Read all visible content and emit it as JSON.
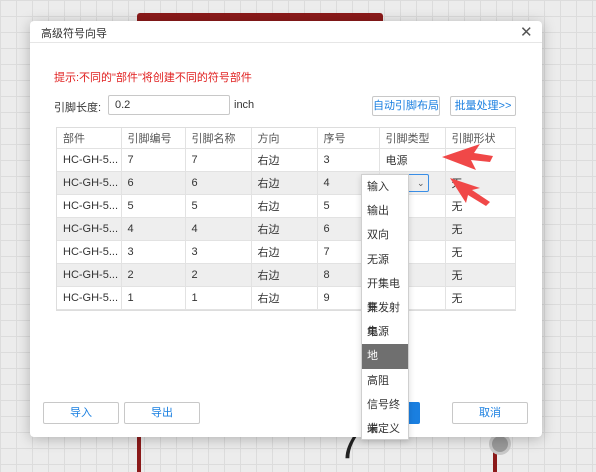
{
  "dialog": {
    "title": "高级符号向导",
    "close_glyph": "✕",
    "hint": "提示:不同的\"部件\"将创建不同的符号部件",
    "pin_length_label": "引脚长度:",
    "pin_length_value": "0.2",
    "pin_length_unit": "inch",
    "auto_layout_label": "自动引脚布局",
    "batch_label": "批量处理>>",
    "import_label": "导入",
    "export_label": "导出",
    "cancel_label": "取消"
  },
  "table": {
    "headers": [
      "部件",
      "引脚编号",
      "引脚名称",
      "方向",
      "序号",
      "引脚类型",
      "引脚形状"
    ],
    "rows": [
      {
        "part": "HC-GH-5...",
        "num": "7",
        "name": "7",
        "dir": "右边",
        "seq": "3",
        "type": "电源",
        "shape": ""
      },
      {
        "part": "HC-GH-5...",
        "num": "6",
        "name": "6",
        "dir": "右边",
        "seq": "4",
        "type": "地",
        "shape": "无"
      },
      {
        "part": "HC-GH-5...",
        "num": "5",
        "name": "5",
        "dir": "右边",
        "seq": "5",
        "type": "",
        "shape": "无"
      },
      {
        "part": "HC-GH-5...",
        "num": "4",
        "name": "4",
        "dir": "右边",
        "seq": "6",
        "type": "",
        "shape": "无"
      },
      {
        "part": "HC-GH-5...",
        "num": "3",
        "name": "3",
        "dir": "右边",
        "seq": "7",
        "type": "",
        "shape": "无"
      },
      {
        "part": "HC-GH-5...",
        "num": "2",
        "name": "2",
        "dir": "右边",
        "seq": "8",
        "type": "",
        "shape": "无"
      },
      {
        "part": "HC-GH-5...",
        "num": "1",
        "name": "1",
        "dir": "右边",
        "seq": "9",
        "type": "",
        "shape": "无"
      }
    ]
  },
  "dropdown": {
    "chevron_glyph": "⌄",
    "options": [
      "输入",
      "输出",
      "双向",
      "无源",
      "开集电集",
      "开发射集",
      "电源",
      "地",
      "高阻",
      "信号终端",
      "未定义"
    ],
    "selected": "地"
  },
  "background": {
    "digit": "7"
  },
  "colors": {
    "accent": "#1a7fe0",
    "hint_red": "#e02020",
    "arrow_red": "#f04848",
    "component_red": "#8b1a1a",
    "highlight_gray": "#6f6f6f"
  }
}
